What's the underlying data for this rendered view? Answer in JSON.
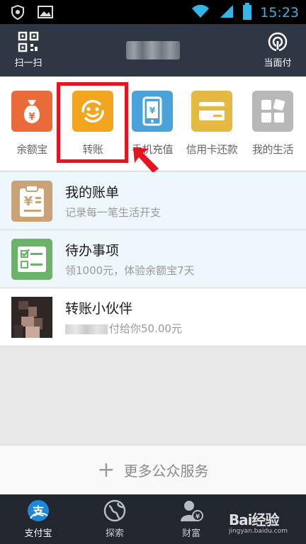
{
  "status_bar": {
    "time": "15:23"
  },
  "top_bar": {
    "scan_label": "扫一扫",
    "pay_label": "当面付"
  },
  "services": [
    {
      "label": "余额宝",
      "color": "#ea6a3a",
      "icon": "money-bag-icon"
    },
    {
      "label": "转账",
      "color": "#f3a520",
      "icon": "transfer-smile-icon"
    },
    {
      "label": "手机充值",
      "color": "#4aa2db",
      "icon": "phone-recharge-icon"
    },
    {
      "label": "信用卡还款",
      "color": "#e6b940",
      "icon": "credit-card-icon"
    },
    {
      "label": "我的生活",
      "color": "#b8b8b8",
      "icon": "grid-icon"
    }
  ],
  "list": [
    {
      "title": "我的账单",
      "subtitle": "记录每一笔生活开支"
    },
    {
      "title": "待办事项",
      "subtitle": "领1000元，体验余额宝7天"
    },
    {
      "title": "转账小伙伴",
      "subtitle": "付给你50.00元"
    }
  ],
  "more_services": "更多公众服务",
  "bottom_nav": [
    {
      "label": "支付宝"
    },
    {
      "label": "探索"
    },
    {
      "label": "财富"
    }
  ],
  "watermark": {
    "brand": "Bai经验",
    "url": "jingyan.baidu.com"
  }
}
